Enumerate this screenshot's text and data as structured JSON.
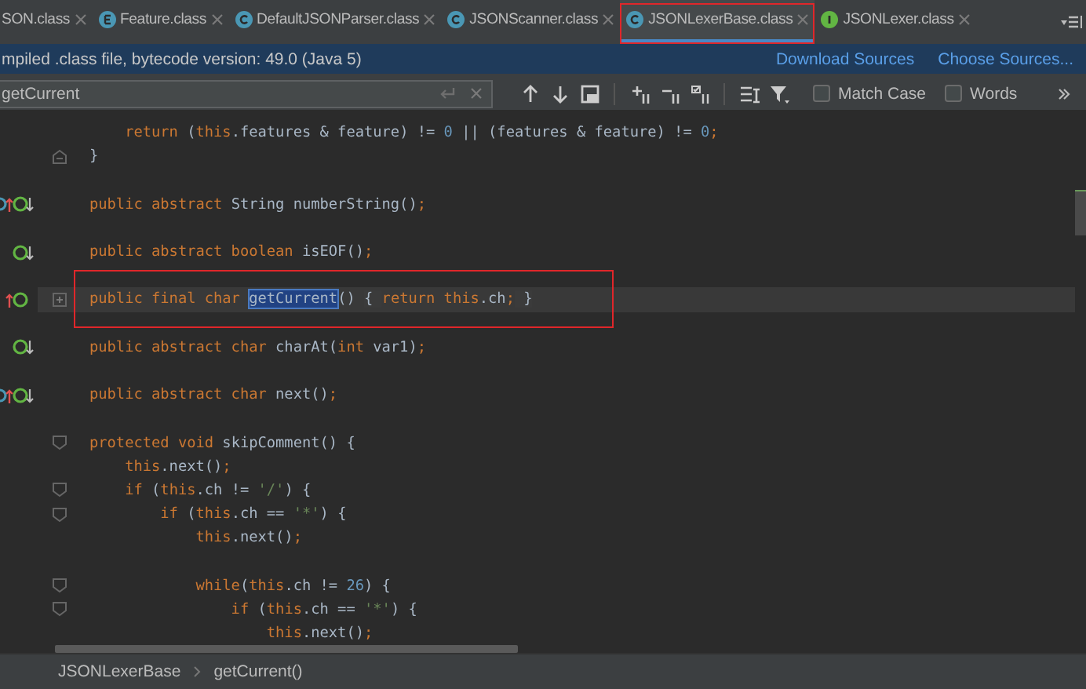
{
  "tabs": [
    {
      "label": "SON.class",
      "kind": "cut",
      "selected": false,
      "annotated": false
    },
    {
      "label": "Feature.class",
      "kind": "enum",
      "selected": false,
      "annotated": false
    },
    {
      "label": "DefaultJSONParser.class",
      "kind": "class",
      "selected": false,
      "annotated": false
    },
    {
      "label": "JSONScanner.class",
      "kind": "class",
      "selected": false,
      "annotated": false
    },
    {
      "label": "JSONLexerBase.class",
      "kind": "class",
      "selected": true,
      "annotated": true
    },
    {
      "label": "JSONLexer.class",
      "kind": "interface",
      "selected": false,
      "annotated": false
    }
  ],
  "info_bar": {
    "message": "mpiled .class file, bytecode version: 49.0 (Java 5)",
    "links": [
      "Download Sources",
      "Choose Sources..."
    ]
  },
  "find_bar": {
    "query": "getCurrent",
    "options": [
      {
        "label": "Match Case",
        "checked": false
      },
      {
        "label": "Words",
        "checked": false
      }
    ]
  },
  "editor": {
    "lines": [
      {
        "kind": "plain",
        "implemented": false,
        "overrides": false,
        "current": false,
        "annotated": false,
        "tokens": [
          {
            "kind": "keyword",
            "text": "    return "
          },
          {
            "kind": "plain",
            "text": "("
          },
          {
            "kind": "keyword",
            "text": "this"
          },
          {
            "kind": "plain",
            "text": ".features & feature) != "
          },
          {
            "kind": "number",
            "text": "0"
          },
          {
            "kind": "plain",
            "text": " || (features & feature) != "
          },
          {
            "kind": "number",
            "text": "0"
          },
          {
            "kind": "keyword",
            "text": ";"
          }
        ]
      },
      {
        "kind": "fold-end",
        "implemented": false,
        "overrides": false,
        "current": false,
        "annotated": false,
        "tokens": [
          {
            "kind": "plain",
            "text": "}"
          }
        ]
      },
      {
        "kind": "blank",
        "implemented": false,
        "overrides": false,
        "current": false,
        "annotated": false
      },
      {
        "kind": "plain",
        "implemented": true,
        "overrides": true,
        "current": false,
        "annotated": false,
        "tokens": [
          {
            "kind": "keyword",
            "text": "public abstract "
          },
          {
            "kind": "plain",
            "text": "String numberString()"
          },
          {
            "kind": "keyword",
            "text": ";"
          }
        ]
      },
      {
        "kind": "blank",
        "implemented": false,
        "overrides": false,
        "current": false,
        "annotated": false
      },
      {
        "kind": "plain",
        "implemented": true,
        "overrides": false,
        "current": false,
        "annotated": false,
        "tokens": [
          {
            "kind": "keyword",
            "text": "public abstract boolean "
          },
          {
            "kind": "plain",
            "text": "isEOF()"
          },
          {
            "kind": "keyword",
            "text": ";"
          }
        ]
      },
      {
        "kind": "blank",
        "implemented": false,
        "overrides": false,
        "current": false,
        "annotated": false
      },
      {
        "kind": "collapsed",
        "implemented": false,
        "overrides": true,
        "current": true,
        "annotated": true,
        "tokens": [
          {
            "kind": "keyword",
            "text": "public final char "
          },
          {
            "kind": "match",
            "text": "getCurrent"
          },
          {
            "kind": "plain",
            "text": "() "
          },
          {
            "kind": "folded",
            "text": "{ "
          },
          {
            "kind": "keyword",
            "text": "return this"
          },
          {
            "kind": "plain",
            "text": ".ch"
          },
          {
            "kind": "keyword",
            "text": ";"
          },
          {
            "kind": "folded",
            "text": " }"
          }
        ]
      },
      {
        "kind": "blank",
        "implemented": false,
        "overrides": false,
        "current": false,
        "annotated": false
      },
      {
        "kind": "plain",
        "implemented": true,
        "overrides": false,
        "current": false,
        "annotated": false,
        "tokens": [
          {
            "kind": "keyword",
            "text": "public abstract char "
          },
          {
            "kind": "plain",
            "text": "charAt("
          },
          {
            "kind": "keyword",
            "text": "int "
          },
          {
            "kind": "plain",
            "text": "var1)"
          },
          {
            "kind": "keyword",
            "text": ";"
          }
        ]
      },
      {
        "kind": "blank",
        "implemented": false,
        "overrides": false,
        "current": false,
        "annotated": false
      },
      {
        "kind": "plain",
        "implemented": true,
        "overrides": true,
        "current": false,
        "annotated": false,
        "tokens": [
          {
            "kind": "keyword",
            "text": "public abstract char "
          },
          {
            "kind": "plain",
            "text": "next()"
          },
          {
            "kind": "keyword",
            "text": ";"
          }
        ]
      },
      {
        "kind": "blank",
        "implemented": false,
        "overrides": false,
        "current": false,
        "annotated": false
      },
      {
        "kind": "fold-start",
        "implemented": false,
        "overrides": false,
        "current": false,
        "annotated": false,
        "tokens": [
          {
            "kind": "keyword",
            "text": "protected void "
          },
          {
            "kind": "plain",
            "text": "skipComment() {"
          }
        ]
      },
      {
        "kind": "plain",
        "implemented": false,
        "overrides": false,
        "current": false,
        "annotated": false,
        "tokens": [
          {
            "kind": "keyword",
            "text": "    this"
          },
          {
            "kind": "plain",
            "text": ".next()"
          },
          {
            "kind": "keyword",
            "text": ";"
          }
        ]
      },
      {
        "kind": "fold-start",
        "implemented": false,
        "overrides": false,
        "current": false,
        "annotated": false,
        "tokens": [
          {
            "kind": "keyword",
            "text": "    if "
          },
          {
            "kind": "plain",
            "text": "("
          },
          {
            "kind": "keyword",
            "text": "this"
          },
          {
            "kind": "plain",
            "text": ".ch != "
          },
          {
            "kind": "string",
            "text": "'/'"
          },
          {
            "kind": "plain",
            "text": ") {"
          }
        ]
      },
      {
        "kind": "fold-start",
        "implemented": false,
        "overrides": false,
        "current": false,
        "annotated": false,
        "tokens": [
          {
            "kind": "keyword",
            "text": "        if "
          },
          {
            "kind": "plain",
            "text": "("
          },
          {
            "kind": "keyword",
            "text": "this"
          },
          {
            "kind": "plain",
            "text": ".ch == "
          },
          {
            "kind": "string",
            "text": "'*'"
          },
          {
            "kind": "plain",
            "text": ") {"
          }
        ]
      },
      {
        "kind": "plain",
        "implemented": false,
        "overrides": false,
        "current": false,
        "annotated": false,
        "tokens": [
          {
            "kind": "keyword",
            "text": "            this"
          },
          {
            "kind": "plain",
            "text": ".next()"
          },
          {
            "kind": "keyword",
            "text": ";"
          }
        ]
      },
      {
        "kind": "blank",
        "implemented": false,
        "overrides": false,
        "current": false,
        "annotated": false
      },
      {
        "kind": "fold-start",
        "implemented": false,
        "overrides": false,
        "current": false,
        "annotated": false,
        "tokens": [
          {
            "kind": "keyword",
            "text": "            while"
          },
          {
            "kind": "plain",
            "text": "("
          },
          {
            "kind": "keyword",
            "text": "this"
          },
          {
            "kind": "plain",
            "text": ".ch != "
          },
          {
            "kind": "number",
            "text": "26"
          },
          {
            "kind": "plain",
            "text": ") {"
          }
        ]
      },
      {
        "kind": "fold-start",
        "implemented": false,
        "overrides": false,
        "current": false,
        "annotated": false,
        "tokens": [
          {
            "kind": "keyword",
            "text": "                if "
          },
          {
            "kind": "plain",
            "text": "("
          },
          {
            "kind": "keyword",
            "text": "this"
          },
          {
            "kind": "plain",
            "text": ".ch == "
          },
          {
            "kind": "string",
            "text": "'*'"
          },
          {
            "kind": "plain",
            "text": ") {"
          }
        ]
      },
      {
        "kind": "plain",
        "implemented": false,
        "overrides": false,
        "current": false,
        "annotated": false,
        "tokens": [
          {
            "kind": "keyword",
            "text": "                    this"
          },
          {
            "kind": "plain",
            "text": ".next()"
          },
          {
            "kind": "keyword",
            "text": ";"
          }
        ]
      }
    ]
  },
  "breadcrumbs": [
    "JSONLexerBase",
    "getCurrent()"
  ]
}
